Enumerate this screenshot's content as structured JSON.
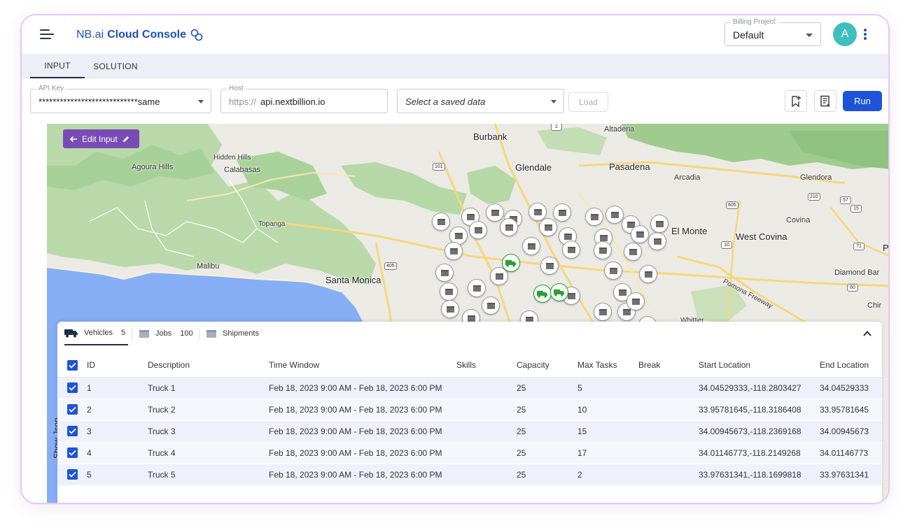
{
  "header": {
    "brand_prefix": "NB.ai",
    "brand_strong": "Cloud Console",
    "billing_legend": "Billing Project",
    "billing_value": "Default",
    "avatar_letter": "A"
  },
  "tabs": [
    {
      "label": "INPUT",
      "active": true
    },
    {
      "label": "SOLUTION",
      "active": false
    }
  ],
  "toolbar": {
    "api_key_legend": "API Key",
    "api_key_value": "****************************same",
    "host_legend": "Host",
    "host_prefix": "https://",
    "host_value": "api.nextbillion.io",
    "saved_placeholder": "Select a saved data",
    "load_label": "Load",
    "run_label": "Run"
  },
  "map": {
    "edit_input_label": "Edit Input",
    "show_json_label": "Show Json",
    "places": [
      "Burbank",
      "Altadena",
      "Glendale",
      "Pasadena",
      "Hidden Hills",
      "Agoura Hills",
      "Calabasas",
      "Arcadia",
      "Glendora",
      "Topanga",
      "El Monte",
      "West Covina",
      "Covina",
      "Malibu",
      "Santa Monica",
      "Diamond Bar",
      "Pomona Freeway",
      "Whittier",
      "Chir",
      "P"
    ],
    "shields": [
      "2",
      "101",
      "210",
      "605",
      "57",
      "10",
      "405",
      "71",
      "60",
      "15"
    ]
  },
  "panel": {
    "tabs": [
      {
        "label": "Vehicles",
        "count": "5",
        "active": true
      },
      {
        "label": "Jobs",
        "count": "100",
        "active": false
      },
      {
        "label": "Shipments",
        "count": "",
        "active": false
      }
    ],
    "columns": [
      "ID",
      "Description",
      "Time Window",
      "Skills",
      "Capacity",
      "Max Tasks",
      "Break",
      "Start Location",
      "End Location"
    ],
    "rows": [
      {
        "id": "1",
        "desc": "Truck 1",
        "window": "Feb 18, 2023 9:00 AM - Feb 18, 2023 6:00 PM",
        "skills": "",
        "capacity": "25",
        "max_tasks": "5",
        "break": "",
        "start": "34.04529333,-118.2803427",
        "end": "34.04529333"
      },
      {
        "id": "2",
        "desc": "Truck 2",
        "window": "Feb 18, 2023 9:00 AM - Feb 18, 2023 6:00 PM",
        "skills": "",
        "capacity": "25",
        "max_tasks": "10",
        "break": "",
        "start": "33.95781645,-118.3186408",
        "end": "33.95781645"
      },
      {
        "id": "3",
        "desc": "Truck 3",
        "window": "Feb 18, 2023 9:00 AM - Feb 18, 2023 6:00 PM",
        "skills": "",
        "capacity": "25",
        "max_tasks": "15",
        "break": "",
        "start": "34.00945673,-118.2369168",
        "end": "34.00945673"
      },
      {
        "id": "4",
        "desc": "Truck 4",
        "window": "Feb 18, 2023 9:00 AM - Feb 18, 2023 6:00 PM",
        "skills": "",
        "capacity": "25",
        "max_tasks": "17",
        "break": "",
        "start": "34.01146773,-118.2149268",
        "end": "34.01146773"
      },
      {
        "id": "5",
        "desc": "Truck 5",
        "window": "Feb 18, 2023 9:00 AM - Feb 18, 2023 6:00 PM",
        "skills": "",
        "capacity": "25",
        "max_tasks": "2",
        "break": "",
        "start": "33.97631341,-118.1699818",
        "end": "33.97631341"
      }
    ]
  },
  "colors": {
    "brand": "#1e4fbf",
    "run": "#1d53d8",
    "edit_input": "#7b4bb5",
    "avatar": "#3fbfbf",
    "frame_border": "#e4c8f0",
    "truck_marker": "#2f9b3a"
  },
  "icons": {
    "menu": "menu-icon",
    "brand_logo": "link-icon",
    "bookmark": "bookmark-add-icon",
    "list": "list-icon",
    "kebab": "more-vert-icon",
    "back": "arrow-left-icon",
    "edit": "pencil-icon",
    "collapse": "chevron-up-icon",
    "vehicle": "truck-icon",
    "job": "box-icon"
  }
}
